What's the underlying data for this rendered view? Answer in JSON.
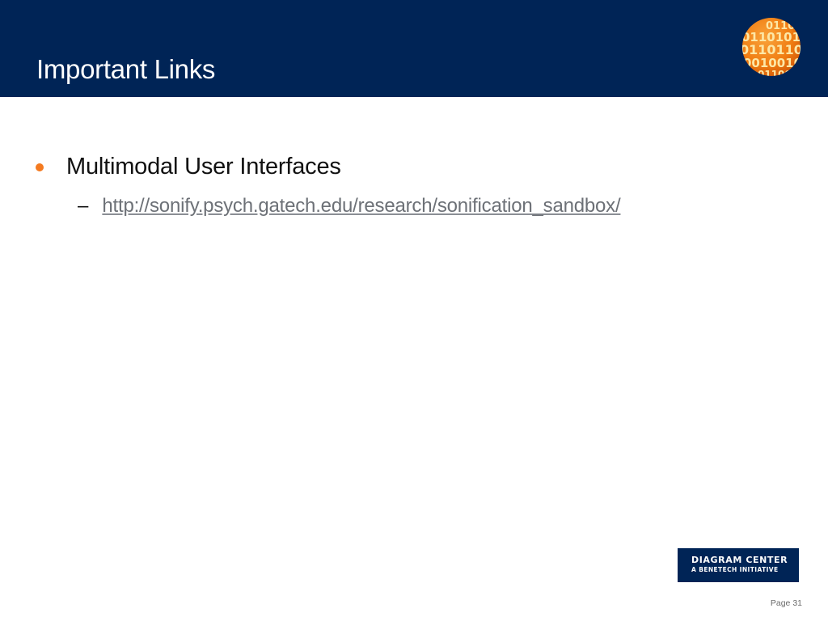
{
  "header": {
    "title": "Important Links",
    "background_color": "#002456",
    "logo_icon": "binary-orb-icon"
  },
  "content": {
    "bullets": [
      {
        "text": "Multimodal User Interfaces",
        "bullet_color": "#f47a20",
        "sub_items": [
          {
            "dash": "–",
            "link_text": "http://sonify.psych.gatech.edu/research/sonification_sandbox/",
            "link_color": "#6d7177"
          }
        ]
      }
    ]
  },
  "footer": {
    "logo_line1": "DIAGRAM CENTER",
    "logo_line2": "A BENETECH INITIATIVE",
    "page_label": "Page 31"
  }
}
